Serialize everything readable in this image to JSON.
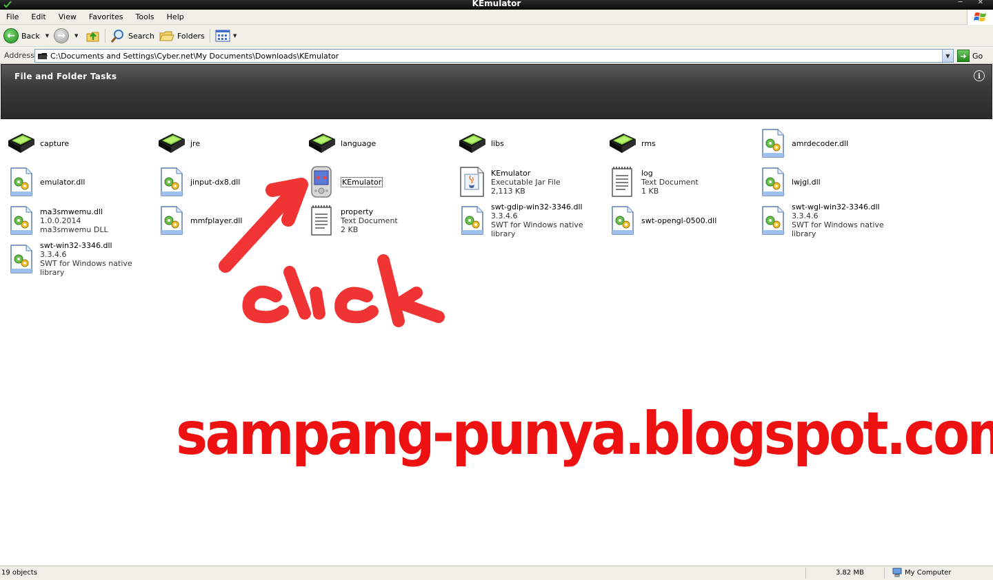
{
  "window": {
    "title": "KEmulator"
  },
  "menu": {
    "items": [
      "File",
      "Edit",
      "View",
      "Favorites",
      "Tools",
      "Help"
    ]
  },
  "toolbar": {
    "back": "Back",
    "search": "Search",
    "folders": "Folders"
  },
  "address": {
    "label": "Address",
    "value": "C:\\Documents and Settings\\Cyber.net\\My Documents\\Downloads\\KEmulator",
    "go": "Go"
  },
  "tasks": {
    "title": "File and Folder Tasks"
  },
  "files": [
    {
      "name": "capture",
      "lines": [],
      "icon": "folder-icon"
    },
    {
      "name": "jre",
      "lines": [],
      "icon": "folder-icon"
    },
    {
      "name": "language",
      "lines": [],
      "icon": "folder-icon"
    },
    {
      "name": "libs",
      "lines": [],
      "icon": "folder-icon"
    },
    {
      "name": "rms",
      "lines": [],
      "icon": "folder-icon"
    },
    {
      "name": "amrdecoder.dll",
      "lines": [],
      "icon": "dll-icon"
    },
    {
      "name": "emulator.dll",
      "lines": [],
      "icon": "dll-icon"
    },
    {
      "name": "jinput-dx8.dll",
      "lines": [],
      "icon": "dll-icon"
    },
    {
      "name": "KEmulator",
      "lines": [],
      "icon": "app-device-icon",
      "selected": true
    },
    {
      "name": "KEmulator",
      "lines": [
        "Executable Jar File",
        "2,113 KB"
      ],
      "icon": "jar-icon"
    },
    {
      "name": "log",
      "lines": [
        "Text Document",
        "1 KB"
      ],
      "icon": "text-doc-icon"
    },
    {
      "name": "lwjgl.dll",
      "lines": [],
      "icon": "dll-icon"
    },
    {
      "name": "ma3smwemu.dll",
      "lines": [
        "1.0.0.2014",
        "ma3smwemu DLL"
      ],
      "icon": "dll-icon"
    },
    {
      "name": "mmfplayer.dll",
      "lines": [],
      "icon": "dll-icon"
    },
    {
      "name": "property",
      "lines": [
        "Text Document",
        "2 KB"
      ],
      "icon": "text-doc-icon"
    },
    {
      "name": "swt-gdip-win32-3346.dll",
      "lines": [
        "3.3.4.6",
        "SWT for Windows native library"
      ],
      "icon": "dll-icon"
    },
    {
      "name": "swt-opengl-0500.dll",
      "lines": [],
      "icon": "dll-icon"
    },
    {
      "name": "swt-wgl-win32-3346.dll",
      "lines": [
        "3.3.4.6",
        "SWT for Windows native library"
      ],
      "icon": "dll-icon"
    },
    {
      "name": "swt-win32-3346.dll",
      "lines": [
        "3.3.4.6",
        "SWT for Windows native library"
      ],
      "icon": "dll-icon"
    }
  ],
  "annotation": {
    "click": "click",
    "watermark": "sampang-punya.blogspot.com",
    "color": "#ee1111"
  },
  "status": {
    "objects": "19 objects",
    "size": "3.82 MB",
    "zone": "My Computer"
  }
}
